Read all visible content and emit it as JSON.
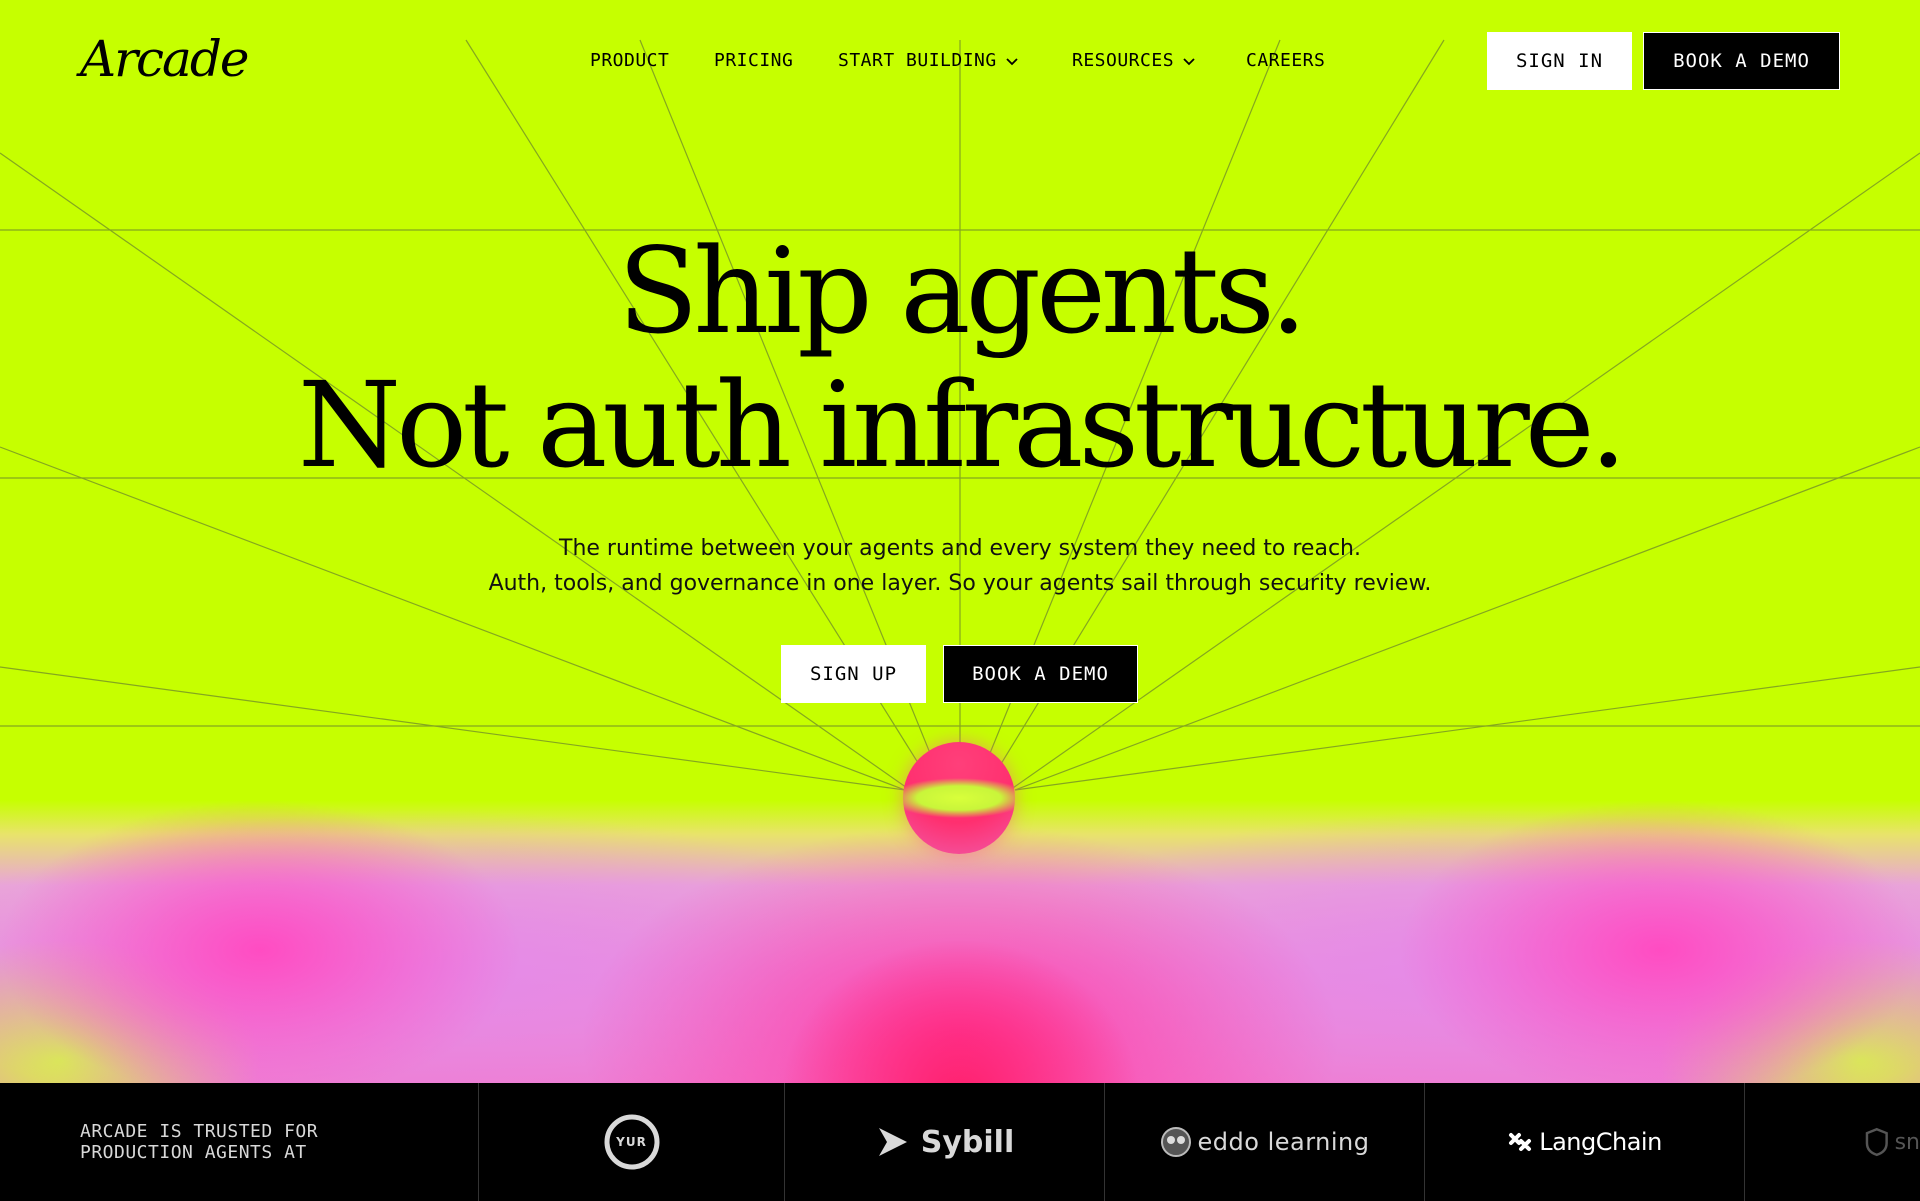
{
  "brand": {
    "logo_text": "Arcade"
  },
  "nav": {
    "items": [
      {
        "label": "PRODUCT",
        "dropdown": false
      },
      {
        "label": "PRICING",
        "dropdown": false
      },
      {
        "label": "START BUILDING",
        "dropdown": true
      },
      {
        "label": "RESOURCES",
        "dropdown": true
      },
      {
        "label": "CAREERS",
        "dropdown": false
      }
    ],
    "sign_in": "SIGN IN",
    "book_demo": "BOOK A DEMO"
  },
  "hero": {
    "title_line1": "Ship agents.",
    "title_line2": "Not auth infrastructure.",
    "subtitle_line1": "The runtime between your agents and every system they need to reach.",
    "subtitle_line2": "Auth, tools, and governance in one layer. So your agents sail through security review.",
    "cta_primary": "SIGN UP",
    "cta_secondary": "BOOK A DEMO"
  },
  "trusted": {
    "label": "ARCADE IS TRUSTED FOR\nPRODUCTION AGENTS AT",
    "logos": [
      {
        "name": "YUR",
        "icon": "yur-circle-logo"
      },
      {
        "name": "Sybill",
        "icon": "sybill-play-logo"
      },
      {
        "name": "eddo learning",
        "icon": "eddo-owl-logo"
      },
      {
        "name": "LangChain",
        "icon": "langchain-knot-logo"
      },
      {
        "name": "sn",
        "icon": "shield-logo"
      }
    ]
  },
  "colors": {
    "background": "#c6ff00",
    "accent_pink": "#ff2f6f",
    "strip": "#000000"
  }
}
